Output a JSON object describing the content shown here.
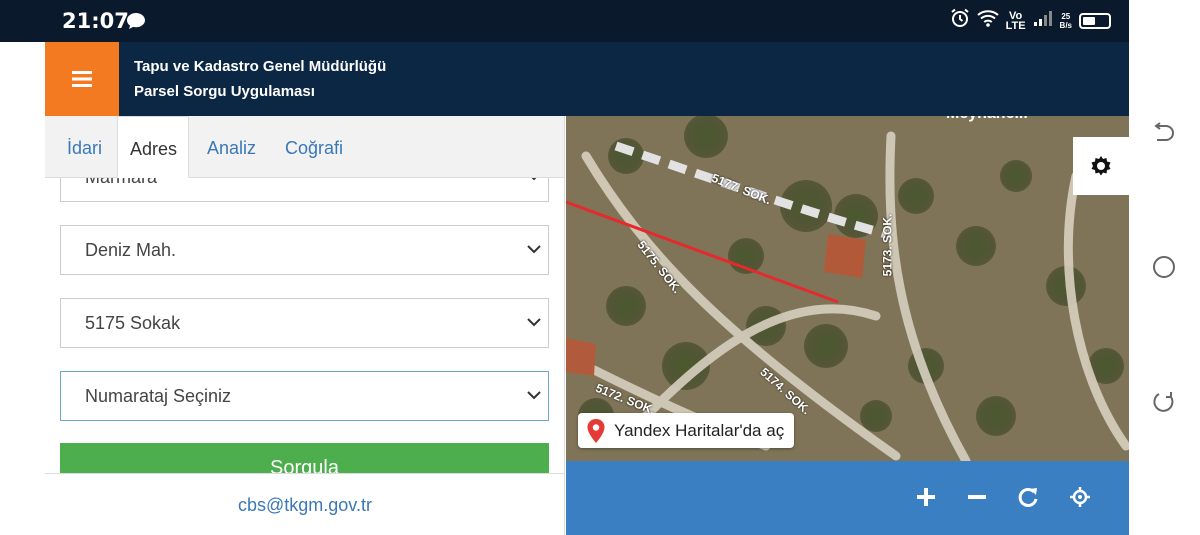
{
  "status_bar": {
    "time": "21:07",
    "chat_icon": "chat-bubble-icon",
    "icons": [
      "alarm-icon",
      "wifi-icon",
      "volte-icon",
      "signal-icon",
      "battery-icon"
    ],
    "volte_top": "Vo",
    "volte_bottom": "LTE",
    "rate_top": "25",
    "rate_bottom": "B/s"
  },
  "header": {
    "title_line1": "Tapu ve Kadastro Genel Müdürlüğü",
    "title_line2": "Parsel Sorgu Uygulaması",
    "menu_icon": "hamburger-menu-icon",
    "accent_color": "#f47a22",
    "bg_color": "#0c2743"
  },
  "tabs": [
    {
      "label": "İdari",
      "active": false
    },
    {
      "label": "Adres",
      "active": true
    },
    {
      "label": "Analiz",
      "active": false
    },
    {
      "label": "Coğrafi",
      "active": false
    }
  ],
  "form": {
    "partial_select": "Marmara",
    "selects": [
      {
        "value": "Deniz Mah."
      },
      {
        "value": "5175 Sokak"
      },
      {
        "value": "Numarataj Seçiniz"
      }
    ],
    "query_button": "Sorgula",
    "query_color": "#4cae4c"
  },
  "footer": {
    "email": "cbs@tkgm.gov.tr"
  },
  "map": {
    "street_labels": [
      "5177. SOK.",
      "5173. SOK.",
      "5175. SOK.",
      "5174. SOK.",
      "5172. SOK."
    ],
    "yandex_link": "Yandex Haritalar'da aç",
    "settings_icon": "gear-icon",
    "toolbar_icons": [
      "zoom-in-icon",
      "zoom-out-icon",
      "refresh-icon",
      "locate-icon"
    ],
    "toolbar_color": "#3a7fc1"
  },
  "nav_bar": {
    "icons": [
      "back-icon",
      "home-icon",
      "recents-icon"
    ]
  }
}
